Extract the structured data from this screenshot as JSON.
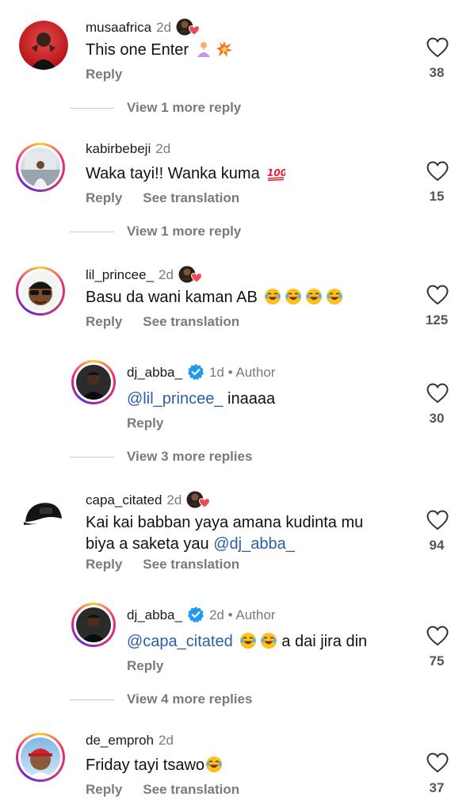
{
  "reply_label": "Reply",
  "see_translation_label": "See translation",
  "comments": [
    {
      "username": "musaafrica",
      "time": "2d",
      "text": "This one Enter",
      "likes": "38",
      "view_more": "View 1 more reply"
    },
    {
      "username": "kabirbebeji",
      "time": "2d",
      "text": "Waka tayi!! Wanka kuma",
      "likes": "15",
      "view_more": "View 1 more reply"
    },
    {
      "username": "lil_princee_",
      "time": "2d",
      "text": "Basu da wani kaman AB",
      "likes": "125"
    },
    {
      "username": "dj_abba_",
      "time": "1d",
      "author_label": "Author",
      "mention": "@lil_princee_",
      "text": " inaaaa",
      "likes": "30",
      "view_more": "View 3 more replies"
    },
    {
      "username": "capa_citated",
      "time": "2d",
      "text_line1": "Kai kai babban yaya amana kudinta mu",
      "text_line2": "biya a saketa yau ",
      "mention": "@dj_abba_",
      "likes": "94"
    },
    {
      "username": "dj_abba_",
      "time": "2d",
      "author_label": "Author",
      "mention": "@capa_citated",
      "text": " a dai jira din",
      "likes": "75",
      "view_more": "View 4 more replies"
    },
    {
      "username": "de_emproh",
      "time": "2d",
      "text": "Friday tayi tsawo",
      "likes": "37"
    }
  ],
  "colors": {
    "mention": "#2b5fa8",
    "verified": "#1d9bf0",
    "liked_heart": "#ed4956",
    "meta": "#7a7a7a"
  },
  "icons": [
    "heart-outline-icon",
    "verified-badge-icon",
    "creator-liked-icon",
    "emoji"
  ]
}
